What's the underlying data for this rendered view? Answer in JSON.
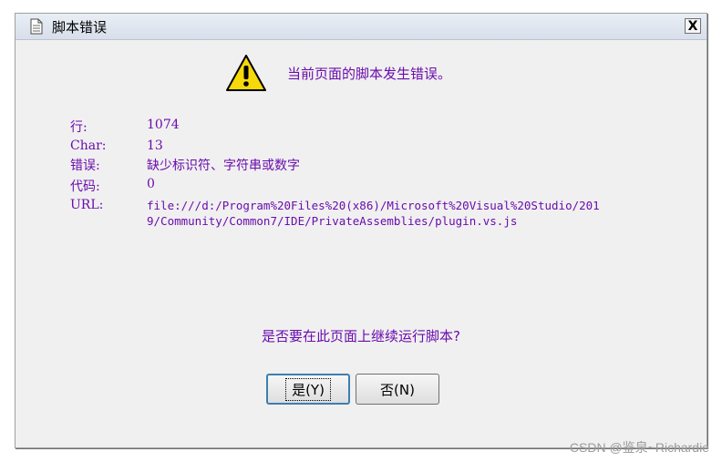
{
  "window": {
    "title": "脚本错误",
    "close_label": "X"
  },
  "header": {
    "message": "当前页面的脚本发生错误。"
  },
  "details": {
    "line_label": "行:",
    "line_value": "1074",
    "char_label": "Char:",
    "char_value": "13",
    "error_label": "错误:",
    "error_value": "缺少标识符、字符串或数字",
    "code_label": "代码:",
    "code_value": "0",
    "url_label": "URL:",
    "url_value": "file:///d:/Program%20Files%20(x86)/Microsoft%20Visual%20Studio/2019/Community/Common7/IDE/PrivateAssemblies/plugin.vs.js"
  },
  "prompt": {
    "question": "是否要在此页面上继续运行脚本?"
  },
  "buttons": {
    "yes_label": "是(Y)",
    "no_label": "否(N)"
  },
  "watermark": "CSDN @鉴泉~Richardie",
  "colors": {
    "text_purple": "#6a0dad",
    "dialog_bg": "#f0f0f0",
    "warning_yellow": "#f5d90a"
  },
  "icons": {
    "title": "document-icon",
    "header": "warning-icon"
  }
}
